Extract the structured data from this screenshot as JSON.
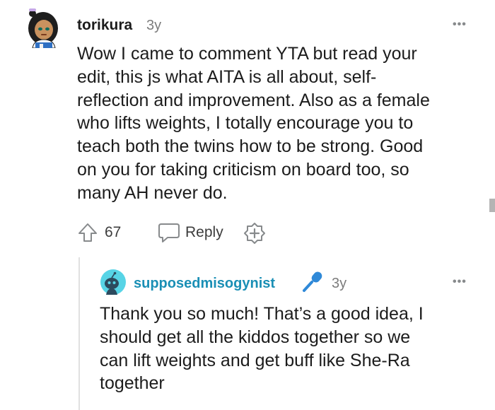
{
  "comment": {
    "author": "torikura",
    "age": "3y",
    "more": "•••",
    "body_lines": [
      "Wow I came to comment YTA but read your",
      "edit, this js what AITA is all about, self-",
      "reflection and improvement. Also as a female",
      "who lifts weights, I totally encourage you to",
      "teach both the twins how to be strong. Good",
      "on you for taking criticism on board too, so",
      "many AH never do."
    ],
    "votes": "67",
    "reply_label": "Reply"
  },
  "reply": {
    "author": "supposedmisogynist",
    "age": "3y",
    "more": "•••",
    "body_lines": [
      "Thank you so much! That’s a good idea, I",
      "should get all the kiddos together so we",
      "can lift weights and get buff like She-Ra",
      "together"
    ]
  },
  "colors": {
    "reply_author": "#1a8fb5",
    "flair_icon": "#2f89d8",
    "meta_gray": "#7c7c7c"
  },
  "icons": {
    "upvote": "upvote-arrow-icon",
    "reply": "speech-bubble-icon",
    "award": "add-award-icon",
    "flair": "microphone-icon"
  }
}
